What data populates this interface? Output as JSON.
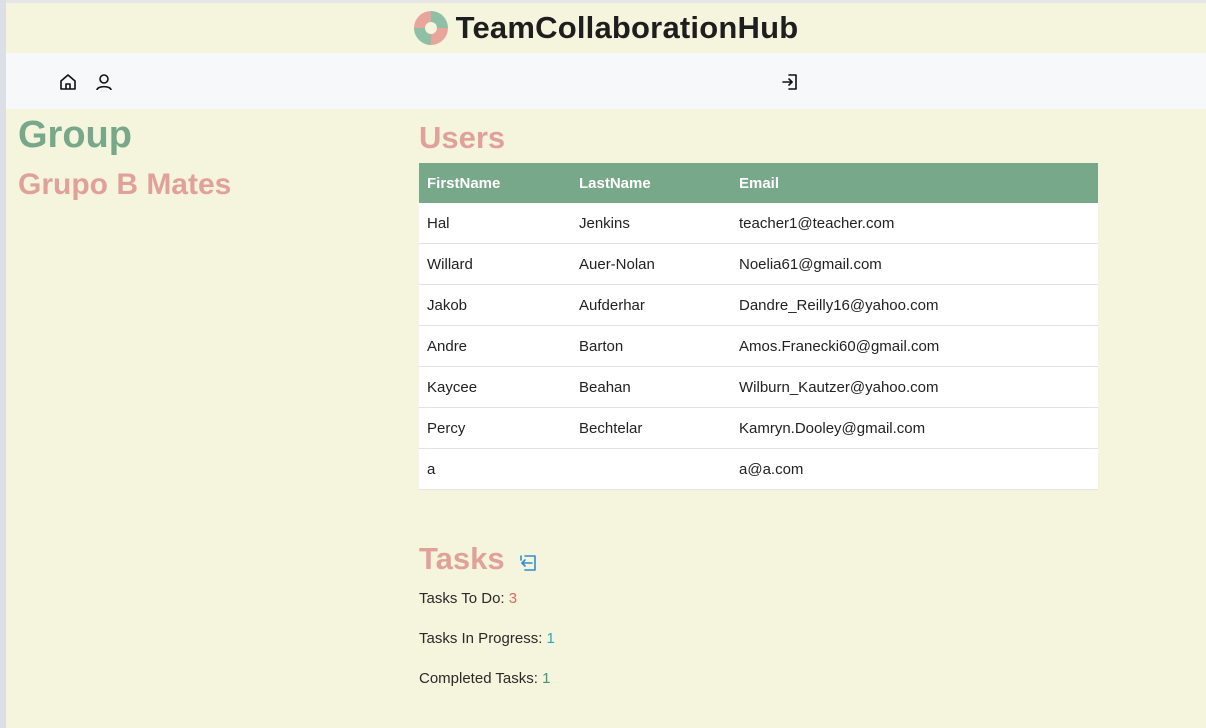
{
  "app": {
    "title": "TeamCollaborationHub"
  },
  "nav": {
    "icons": [
      "home-icon",
      "user-icon",
      "login-icon"
    ]
  },
  "group": {
    "heading": "Group",
    "name": "Grupo B Mates"
  },
  "users": {
    "heading": "Users",
    "columns": [
      "FirstName",
      "LastName",
      "Email"
    ],
    "rows": [
      [
        "Hal",
        "Jenkins",
        "teacher1@teacher.com"
      ],
      [
        "Willard",
        "Auer-Nolan",
        "Noelia61@gmail.com"
      ],
      [
        "Jakob",
        "Aufderhar",
        "Dandre_Reilly16@yahoo.com"
      ],
      [
        "Andre",
        "Barton",
        "Amos.Franecki60@gmail.com"
      ],
      [
        "Kaycee",
        "Beahan",
        "Wilburn_Kautzer@yahoo.com"
      ],
      [
        "Percy",
        "Bechtelar",
        "Kamryn.Dooley@gmail.com"
      ],
      [
        "a",
        "",
        "a@a.com"
      ]
    ]
  },
  "tasks": {
    "heading": "Tasks",
    "todo_label": "Tasks To Do: ",
    "todo_count": "3",
    "in_progress_label": "Tasks In Progress: ",
    "in_progress_count": "1",
    "completed_label": "Completed Tasks: ",
    "completed_count": "1"
  },
  "colors": {
    "background": "#f5f4dc",
    "accent_green": "#78a88a",
    "accent_pink": "#e0a19c",
    "todo": "#e06a60",
    "in_progress": "#2ca5c6",
    "completed": "#3b9a7d"
  }
}
